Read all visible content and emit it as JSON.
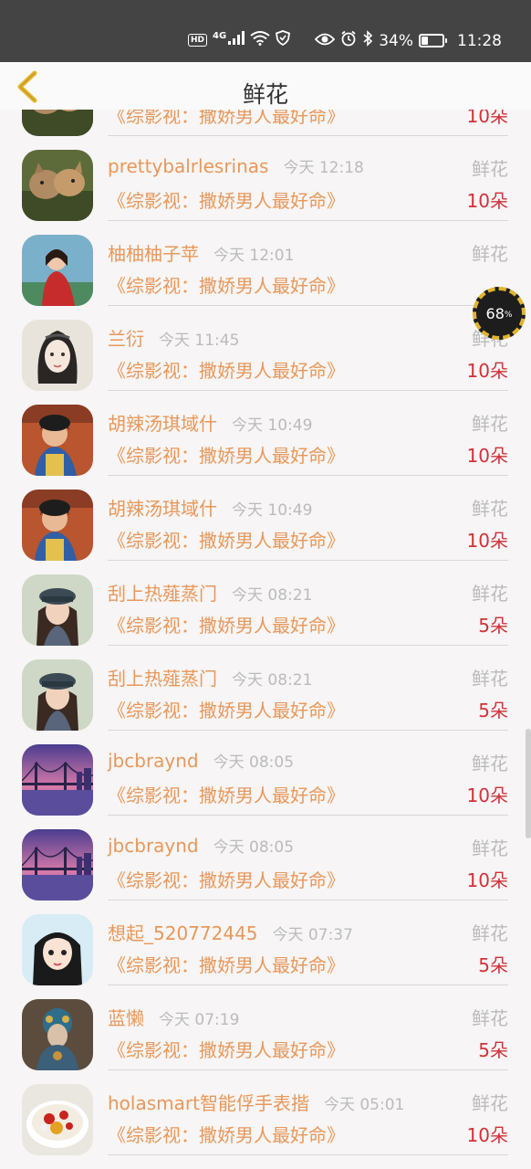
{
  "status_bar": {
    "hd": "HD",
    "network": "4G",
    "battery_text": "34%",
    "battery_level": 0.34,
    "time": "11:28",
    "icons": [
      "signal-icon",
      "wifi-icon",
      "vpn-shield-icon",
      "eye-icon",
      "alarm-icon",
      "bluetooth-icon",
      "battery-icon"
    ]
  },
  "header": {
    "title": "鲜花",
    "back_icon": "chevron-left-icon",
    "accent": "#e8b62a"
  },
  "overlay": {
    "speed_percent": "68",
    "unit": "%"
  },
  "rows": [
    {
      "nick": "",
      "time": "",
      "gift": "",
      "book": "《综影视：撒娇男人最好命》",
      "count": "10朵",
      "avatar": "cats"
    },
    {
      "nick": "prettybalrlesrinas",
      "time": "今天 12:18",
      "gift": "鲜花",
      "book": "《综影视：撒娇男人最好命》",
      "count": "10朵",
      "avatar": "cats"
    },
    {
      "nick": "柚柚柚子苹",
      "time": "今天 12:01",
      "gift": "鲜花",
      "book": "《综影视：撒娇男人最好命》",
      "count": "",
      "avatar": "girl-red"
    },
    {
      "nick": "兰衍",
      "time": "今天 11:45",
      "gift": "鲜花",
      "book": "《综影视：撒娇男人最好命》",
      "count": "10朵",
      "avatar": "drawing"
    },
    {
      "nick": "胡辣汤琪域什",
      "time": "今天 10:49",
      "gift": "鲜花",
      "book": "《综影视：撒娇男人最好命》",
      "count": "10朵",
      "avatar": "boy"
    },
    {
      "nick": "胡辣汤琪域什",
      "time": "今天 10:49",
      "gift": "鲜花",
      "book": "《综影视：撒娇男人最好命》",
      "count": "10朵",
      "avatar": "boy"
    },
    {
      "nick": "刮上热薤蒸门",
      "time": "今天 08:21",
      "gift": "鲜花",
      "book": "《综影视：撒娇男人最好命》",
      "count": "5朵",
      "avatar": "cap-girl"
    },
    {
      "nick": "刮上热薤蒸门",
      "time": "今天 08:21",
      "gift": "鲜花",
      "book": "《综影视：撒娇男人最好命》",
      "count": "5朵",
      "avatar": "cap-girl"
    },
    {
      "nick": "jbcbraynd",
      "time": "今天 08:05",
      "gift": "鲜花",
      "book": "《综影视：撒娇男人最好命》",
      "count": "10朵",
      "avatar": "bridge"
    },
    {
      "nick": "jbcbraynd",
      "time": "今天 08:05",
      "gift": "鲜花",
      "book": "《综影视：撒娇男人最好命》",
      "count": "10朵",
      "avatar": "bridge"
    },
    {
      "nick": "想起_520772445",
      "time": "今天 07:37",
      "gift": "鲜花",
      "book": "《综影视：撒娇男人最好命》",
      "count": "5朵",
      "avatar": "cartoon-girl"
    },
    {
      "nick": "蓝懒",
      "time": "今天 07:19",
      "gift": "鲜花",
      "book": "《综影视：撒娇男人最好命》",
      "count": "5朵",
      "avatar": "ornate"
    },
    {
      "nick": "holasmart智能俘手表揩",
      "time": "今天 05:01",
      "gift": "鲜花",
      "book": "《综影视：撒娇男人最好命》",
      "count": "10朵",
      "avatar": "food"
    }
  ],
  "colors": {
    "name": "#e8985a",
    "count": "#d0323a",
    "muted": "#bbbbbb"
  }
}
